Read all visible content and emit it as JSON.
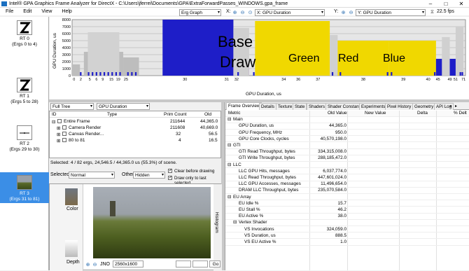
{
  "window": {
    "title": "Intel® GPA Graphics Frame Analyzer for DirectX - C:\\Users\\jferrei\\Documents\\GPA\\ExtraForwardPasses_WINDOWS.gpa_frame"
  },
  "menu": [
    "File",
    "Edit",
    "View",
    "Help"
  ],
  "toolbar": {
    "graph_mode": "Erg Graph",
    "x_label": "X:",
    "x_metric": "X: GPU Duration",
    "y_label": "Y:",
    "y_metric": "Y: GPU Duration",
    "fps": "22.5 fps"
  },
  "render_targets": [
    {
      "name": "RT 0",
      "ergs": "(Ergs 0 to 4)"
    },
    {
      "name": "RT 1",
      "ergs": "(Ergs 5 to 28)"
    },
    {
      "name": "RT 2",
      "ergs": "(Ergs 29 to 30)"
    },
    {
      "name": "RT 3",
      "ergs": "(Ergs 31 to 81)"
    }
  ],
  "chart_data": {
    "type": "bar",
    "ylabel": "GPU Duration, us",
    "xlabel": "GPU Duration, us",
    "yticks": [
      "8000",
      "7000",
      "6000",
      "5000",
      "4000",
      "3000",
      "2000",
      "1000",
      "0"
    ],
    "xticks": [
      "0",
      "2",
      "5",
      "6",
      "9",
      "15",
      "19",
      "25",
      "30",
      "31",
      "32",
      "34",
      "36",
      "37",
      "38",
      "39",
      "40",
      "45",
      "49",
      "51",
      "71"
    ],
    "ylim": [
      0,
      8000
    ],
    "annotations": [
      "Base",
      "Draw",
      "Green",
      "Red",
      "Blue"
    ],
    "colors": {
      "selected": "#1e1ec8",
      "highlight": "#f0d800",
      "purple": "#9a30d8",
      "background": "#c8c8c8"
    }
  },
  "tree_toolbar": {
    "view": "Full Tree",
    "metric": "GPU Duration"
  },
  "tree": {
    "columns": [
      "ID",
      "Type",
      "Prim Count",
      "Old"
    ],
    "rows": [
      {
        "name": "Entire Frame",
        "prim": "211644",
        "old": "44,365.0"
      },
      {
        "name": "Camera Render",
        "prim": "211608",
        "old": "40,669.0"
      },
      {
        "name": "Canvas Render...",
        "prim": "32",
        "old": "56.5"
      },
      {
        "name": "80 to 81",
        "prim": "4",
        "old": "16.5"
      }
    ]
  },
  "selection_info": "Selected: 4 / 82 ergs, 24,546.5 / 44,365.0 us (55.3%) of scene.",
  "image_toolbar": {
    "selected_label": "Selected",
    "selected_value": "Normal",
    "other_label": "Other",
    "other_value": "Hidden",
    "clear_before": "Clear before drawing",
    "draw_only": "Draw only to last selected"
  },
  "image_pane": {
    "color_label": "Color",
    "depth_label": "Depth",
    "zoom_mode": "JNO",
    "resolution": "2560x1600",
    "go_label": "Go",
    "histogram_label": "Histogram"
  },
  "tabs": [
    "Frame Overview",
    "Details",
    "Texture",
    "State",
    "Shaders",
    "Shader Constants",
    "Experiments",
    "Pixel History",
    "Geometry",
    "API Log"
  ],
  "metrics": {
    "columns": [
      "Metric",
      "Old Value",
      "New Value",
      "Delta",
      "% Delt"
    ],
    "rows": [
      {
        "name": "Main",
        "value": "",
        "section": true,
        "indent": 0
      },
      {
        "name": "GPU Duration, us",
        "value": "44,365.0",
        "indent": 1
      },
      {
        "name": "GPU Frequency, MHz",
        "value": "950.0",
        "indent": 1
      },
      {
        "name": "GPU Core Clocks, cycles",
        "value": "40,570,198.0",
        "indent": 1
      },
      {
        "name": "GTI",
        "value": "",
        "section": true,
        "indent": 0
      },
      {
        "name": "GTI Read Throughput, bytes",
        "value": "334,315,008.0",
        "indent": 1
      },
      {
        "name": "GTI Write Throughput, bytes",
        "value": "288,185,472.0",
        "indent": 1
      },
      {
        "name": "LLC",
        "value": "",
        "section": true,
        "indent": 0
      },
      {
        "name": "LLC GPU Hits, messages",
        "value": "6,037,774.0",
        "indent": 1
      },
      {
        "name": "LLC Read Throughput, bytes",
        "value": "447,601,024.0",
        "indent": 1
      },
      {
        "name": "LLC GPU Accesses, messages",
        "value": "11,496,654.0",
        "indent": 1
      },
      {
        "name": "DRAM LLC Throughput, bytes",
        "value": "235,070,584.0",
        "indent": 1
      },
      {
        "name": "EU Array",
        "value": "",
        "section": true,
        "indent": 0
      },
      {
        "name": "EU Idle %",
        "value": "15.7",
        "indent": 1
      },
      {
        "name": "EU Stall %",
        "value": "46.2",
        "indent": 1
      },
      {
        "name": "EU Active %",
        "value": "38.0",
        "indent": 1
      },
      {
        "name": "Vertex Shader",
        "value": "",
        "section": true,
        "indent": 1
      },
      {
        "name": "VS Invocations",
        "value": "324,059.0",
        "indent": 2
      },
      {
        "name": "VS Duration, us",
        "value": "888.5",
        "indent": 2
      },
      {
        "name": "VS EU Active %",
        "value": "1.0",
        "indent": 2
      }
    ]
  }
}
